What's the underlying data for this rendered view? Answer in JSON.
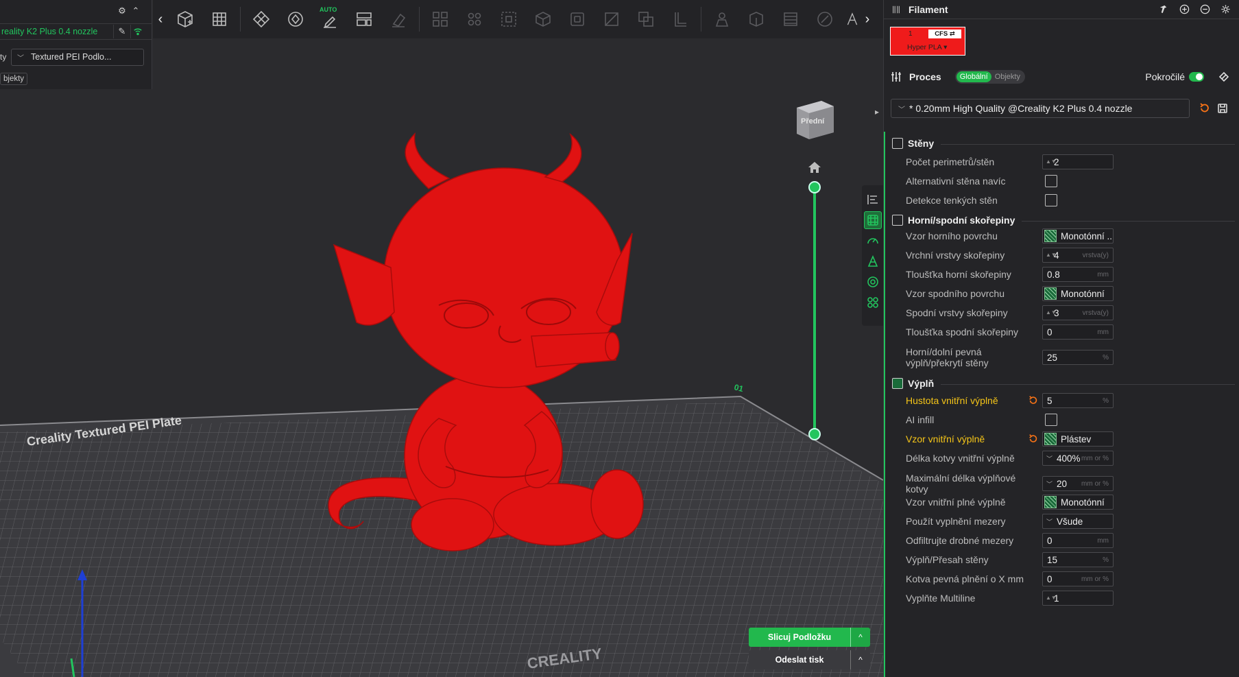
{
  "printer": {
    "name": "reality K2 Plus 0.4 nozzle",
    "plate_label": "ty",
    "plate_type": "Textured PEI Podlo...",
    "objects_chip": "bjekty"
  },
  "toolbar": {
    "collapse_left": "‹",
    "collapse_right": "›",
    "auto_badge": "AUTO",
    "buttons": [
      "add-object",
      "arrange-grid",
      "orient",
      "auto-orient",
      "auto-arrange",
      "split-plates",
      "paint",
      "layout-1",
      "layout-2",
      "scale",
      "cube-box",
      "hollow",
      "cut",
      "boolean",
      "support",
      "lift",
      "measure",
      "fill",
      "paint-brush",
      "text"
    ]
  },
  "viewport": {
    "view_cube_label": "Přední",
    "plate_title": "Creality Textured PEI Plate",
    "plate_brand": "CREALITY",
    "plate_number": "01",
    "model_color": "#e01212",
    "layer_slider": {
      "top_fraction": 1.0,
      "bottom_fraction": 0.0
    }
  },
  "actions": {
    "slice_label": "Slicuj Podložku",
    "send_label": "Odeslat tisk",
    "slice_menu": "^",
    "send_menu": "^"
  },
  "right_panel": {
    "filament_title": "Filament",
    "filament": {
      "slot": "1",
      "cfs": "CFS ⇄",
      "name": "Hyper PLA ▾",
      "color": "#ef1b1b"
    },
    "process_title": "Proces",
    "scope_global": "Globální",
    "scope_objects": "Objekty",
    "advanced_label": "Pokročilé",
    "preset": "* 0.20mm High Quality @Creality K2 Plus 0.4 nozzle"
  },
  "sections": {
    "walls": {
      "title": "Stěny",
      "rows": [
        {
          "label": "Počet perimetrů/stěn",
          "value": "2",
          "unit": ""
        },
        {
          "label": "Alternativní stěna navíc",
          "checked": false
        },
        {
          "label": "Detekce tenkých stěn",
          "checked": false
        }
      ]
    },
    "shells": {
      "title": "Horní/spodní skořepiny",
      "rows": [
        {
          "label": "Vzor horního povrchu",
          "value": "Monotónní ..."
        },
        {
          "label": "Vrchní vrstvy skořepiny",
          "value": "4",
          "unit": "vrstva(y)"
        },
        {
          "label": "Tloušťka horní skořepiny",
          "value": "0.8",
          "unit": "mm"
        },
        {
          "label": "Vzor spodního povrchu",
          "value": "Monotónní"
        },
        {
          "label": "Spodní vrstvy skořepiny",
          "value": "3",
          "unit": "vrstva(y)"
        },
        {
          "label": "Tloušťka spodní skořepiny",
          "value": "0",
          "unit": "mm"
        },
        {
          "label": "Horní/dolní pevná výplň/překrytí stěny",
          "value": "25",
          "unit": "%"
        }
      ]
    },
    "infill": {
      "title": "Výplň",
      "rows": [
        {
          "label": "Hustota vnitřní výplně",
          "value": "5",
          "unit": "%"
        },
        {
          "label": "AI infill",
          "checked": false
        },
        {
          "label": "Vzor vnitřní výplně",
          "value": "Plástev"
        },
        {
          "label": "Délka kotvy vnitřní výplně",
          "value": "400%",
          "unit": "mm or %"
        },
        {
          "label": "Maximální délka výplňové kotvy",
          "value": "20",
          "unit": "mm or %"
        },
        {
          "label": "Vzor vnitřní plné výplně",
          "value": "Monotónní"
        },
        {
          "label": "Použít vyplnění mezery",
          "value": "Všude"
        },
        {
          "label": "Odfiltrujte drobné mezery",
          "value": "0",
          "unit": "mm"
        },
        {
          "label": "Výplň/Přesah stěny",
          "value": "15",
          "unit": "%"
        },
        {
          "label": "Kotva pevná plnění o X mm",
          "value": "0",
          "unit": "mm or %"
        },
        {
          "label": "Vyplňte Multiline",
          "value": "1",
          "unit": ""
        }
      ]
    }
  }
}
